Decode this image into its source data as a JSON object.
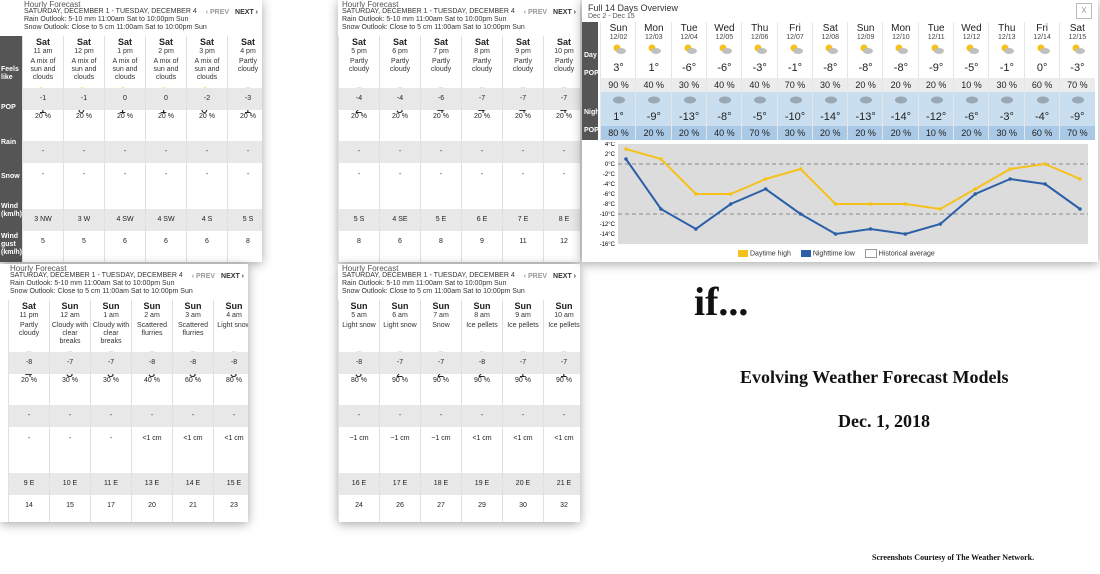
{
  "hourly_common": {
    "title": "Hourly Forecast",
    "date_range": "SATURDAY, DECEMBER 1 - TUESDAY, DECEMBER 4",
    "rain_outlook": "Rain Outlook: 5-10 mm 11:00am Sat to 10:00pm Sun",
    "snow_outlook": "Snow Outlook: Close to 5 cm 11:00am Sat to 10:00pm Sun",
    "prev": "‹ PREV",
    "next": "NEXT ›"
  },
  "row_labels": {
    "feels": "Feels like",
    "pop": "POP",
    "rain": "Rain",
    "snow": "Snow",
    "wind": "Wind (km/h)",
    "gust": "Wind gust (km/h)"
  },
  "panels": [
    {
      "cols": [
        {
          "day": "Sat",
          "time": "11 am",
          "cond": "A mix of sun and clouds",
          "icon": "sun-cloud-icon",
          "temp": "-1°",
          "feels": "-1",
          "pop": "20 %",
          "rain": "-",
          "snow": "-",
          "wind": "3 NW",
          "gust": "5"
        },
        {
          "day": "Sat",
          "time": "12 pm",
          "cond": "A mix of sun and clouds",
          "icon": "sun-cloud-icon",
          "temp": "0°",
          "feels": "-1",
          "pop": "20 %",
          "rain": "-",
          "snow": "-",
          "wind": "3 W",
          "gust": "5"
        },
        {
          "day": "Sat",
          "time": "1 pm",
          "cond": "A mix of sun and clouds",
          "icon": "sun-cloud-icon",
          "temp": "1°",
          "feels": "0",
          "pop": "20 %",
          "rain": "-",
          "snow": "-",
          "wind": "4 SW",
          "gust": "6"
        },
        {
          "day": "Sat",
          "time": "2 pm",
          "cond": "A mix of sun and clouds",
          "icon": "sun-cloud-icon",
          "temp": "1°",
          "feels": "0",
          "pop": "20 %",
          "rain": "-",
          "snow": "-",
          "wind": "4 SW",
          "gust": "6"
        },
        {
          "day": "Sat",
          "time": "3 pm",
          "cond": "A mix of sun and clouds",
          "icon": "sun-cloud-icon",
          "temp": "0°",
          "feels": "-2",
          "pop": "20 %",
          "rain": "-",
          "snow": "-",
          "wind": "4 S",
          "gust": "6"
        },
        {
          "day": "Sat",
          "time": "4 pm",
          "cond": "Partly cloudy",
          "icon": "cloud-icon",
          "temp": "-1°",
          "feels": "-3",
          "pop": "20 %",
          "rain": "-",
          "snow": "-",
          "wind": "5 S",
          "gust": "8"
        }
      ]
    },
    {
      "cols": [
        {
          "day": "Sat",
          "time": "5 pm",
          "cond": "Partly cloudy",
          "icon": "cloud-icon",
          "temp": "-2°",
          "feels": "-4",
          "pop": "20 %",
          "rain": "-",
          "snow": "-",
          "wind": "5 S",
          "gust": "8"
        },
        {
          "day": "Sat",
          "time": "6 pm",
          "cond": "Partly cloudy",
          "icon": "cloud-icon",
          "temp": "-3°",
          "feels": "-4",
          "pop": "20 %",
          "rain": "-",
          "snow": "-",
          "wind": "4 SE",
          "gust": "6"
        },
        {
          "day": "Sat",
          "time": "7 pm",
          "cond": "Partly cloudy",
          "icon": "cloud-icon",
          "temp": "-4°",
          "feels": "-6",
          "pop": "20 %",
          "rain": "-",
          "snow": "-",
          "wind": "5 E",
          "gust": "8"
        },
        {
          "day": "Sat",
          "time": "8 pm",
          "cond": "Partly cloudy",
          "icon": "cloud-icon",
          "temp": "-4°",
          "feels": "-7",
          "pop": "20 %",
          "rain": "-",
          "snow": "-",
          "wind": "6 E",
          "gust": "9"
        },
        {
          "day": "Sat",
          "time": "9 pm",
          "cond": "Partly cloudy",
          "icon": "cloud-icon",
          "temp": "-4°",
          "feels": "-7",
          "pop": "20 %",
          "rain": "-",
          "snow": "-",
          "wind": "7 E",
          "gust": "11"
        },
        {
          "day": "Sat",
          "time": "10 pm",
          "cond": "Partly cloudy",
          "icon": "cloud-icon",
          "temp": "-4°",
          "feels": "-7",
          "pop": "20 %",
          "rain": "-",
          "snow": "-",
          "wind": "8 E",
          "gust": "12"
        }
      ]
    },
    {
      "cols": [
        {
          "day": "Sat",
          "time": "11 pm",
          "cond": "Partly cloudy",
          "icon": "cloud-icon",
          "temp": "-4°",
          "feels": "-8",
          "pop": "20 %",
          "rain": "-",
          "snow": "-",
          "wind": "9 E",
          "gust": "14"
        },
        {
          "day": "Sun",
          "time": "12 am",
          "cond": "Cloudy with clear breaks",
          "icon": "cloud-icon",
          "temp": "-3°",
          "feels": "-7",
          "pop": "30 %",
          "rain": "-",
          "snow": "-",
          "wind": "10 E",
          "gust": "15"
        },
        {
          "day": "Sun",
          "time": "1 am",
          "cond": "Cloudy with clear breaks",
          "icon": "cloud-icon",
          "temp": "-3°",
          "feels": "-7",
          "pop": "30 %",
          "rain": "-",
          "snow": "-",
          "wind": "11 E",
          "gust": "17"
        },
        {
          "day": "Sun",
          "time": "2 am",
          "cond": "Scattered flurries",
          "icon": "flurries-icon",
          "temp": "-3°",
          "feels": "-8",
          "pop": "40 %",
          "rain": "-",
          "snow": "<1 cm",
          "wind": "13 E",
          "gust": "20"
        },
        {
          "day": "Sun",
          "time": "3 am",
          "cond": "Scattered flurries",
          "icon": "flurries-icon",
          "temp": "-3°",
          "feels": "-8",
          "pop": "60 %",
          "rain": "-",
          "snow": "<1 cm",
          "wind": "14 E",
          "gust": "21"
        },
        {
          "day": "Sun",
          "time": "4 am",
          "cond": "Light snow",
          "icon": "snow-icon",
          "temp": "-3°",
          "feels": "-8",
          "pop": "80 %",
          "rain": "-",
          "snow": "<1 cm",
          "wind": "15 E",
          "gust": "23"
        }
      ]
    },
    {
      "cols": [
        {
          "day": "Sun",
          "time": "5 am",
          "cond": "Light snow",
          "icon": "snow-icon",
          "temp": "-3°",
          "feels": "-8",
          "pop": "80 %",
          "rain": "-",
          "snow": "~1 cm",
          "wind": "16 E",
          "gust": "24"
        },
        {
          "day": "Sun",
          "time": "6 am",
          "cond": "Light snow",
          "icon": "snow-icon",
          "temp": "-2°",
          "feels": "-7",
          "pop": "90 %",
          "rain": "-",
          "snow": "~1 cm",
          "wind": "17 E",
          "gust": "26"
        },
        {
          "day": "Sun",
          "time": "7 am",
          "cond": "Snow",
          "icon": "snow-icon",
          "temp": "-2°",
          "feels": "-7",
          "pop": "90 %",
          "rain": "-",
          "snow": "~1 cm",
          "wind": "18 E",
          "gust": "27"
        },
        {
          "day": "Sun",
          "time": "8 am",
          "cond": "Ice pellets",
          "icon": "ice-pellets-icon",
          "temp": "-2°",
          "feels": "-8",
          "pop": "90 %",
          "rain": "-",
          "snow": "<1 cm",
          "wind": "19 E",
          "gust": "29"
        },
        {
          "day": "Sun",
          "time": "9 am",
          "cond": "Ice pellets",
          "icon": "ice-pellets-icon",
          "temp": "-1°",
          "feels": "-7",
          "pop": "90 %",
          "rain": "-",
          "snow": "<1 cm",
          "wind": "20 E",
          "gust": "30"
        },
        {
          "day": "Sun",
          "time": "10 am",
          "cond": "Ice pellets",
          "icon": "ice-pellets-icon",
          "temp": "-1°",
          "feels": "-7",
          "pop": "90 %",
          "rain": "-",
          "snow": "<1 cm",
          "wind": "21 E",
          "gust": "32"
        }
      ]
    }
  ],
  "overview": {
    "title": "Full 14 Days Overview",
    "range": "Dec 2 - Dec 15",
    "close": "X",
    "labels": {
      "day": "Day",
      "pop": "POP",
      "night": "Night"
    },
    "days": [
      {
        "day": "Sun",
        "date": "12/02",
        "day_temp": "3°",
        "day_pop": "90 %",
        "night_temp": "1°",
        "night_pop": "80 %"
      },
      {
        "day": "Mon",
        "date": "12/03",
        "day_temp": "1°",
        "day_pop": "40 %",
        "night_temp": "-9°",
        "night_pop": "20 %"
      },
      {
        "day": "Tue",
        "date": "12/04",
        "day_temp": "-6°",
        "day_pop": "30 %",
        "night_temp": "-13°",
        "night_pop": "20 %"
      },
      {
        "day": "Wed",
        "date": "12/05",
        "day_temp": "-6°",
        "day_pop": "40 %",
        "night_temp": "-8°",
        "night_pop": "40 %"
      },
      {
        "day": "Thu",
        "date": "12/06",
        "day_temp": "-3°",
        "day_pop": "40 %",
        "night_temp": "-5°",
        "night_pop": "70 %"
      },
      {
        "day": "Fri",
        "date": "12/07",
        "day_temp": "-1°",
        "day_pop": "70 %",
        "night_temp": "-10°",
        "night_pop": "30 %"
      },
      {
        "day": "Sat",
        "date": "12/08",
        "day_temp": "-8°",
        "day_pop": "30 %",
        "night_temp": "-14°",
        "night_pop": "20 %"
      },
      {
        "day": "Sun",
        "date": "12/09",
        "day_temp": "-8°",
        "day_pop": "20 %",
        "night_temp": "-13°",
        "night_pop": "20 %"
      },
      {
        "day": "Mon",
        "date": "12/10",
        "day_temp": "-8°",
        "day_pop": "20 %",
        "night_temp": "-14°",
        "night_pop": "20 %"
      },
      {
        "day": "Tue",
        "date": "12/11",
        "day_temp": "-9°",
        "day_pop": "20 %",
        "night_temp": "-12°",
        "night_pop": "10 %"
      },
      {
        "day": "Wed",
        "date": "12/12",
        "day_temp": "-5°",
        "day_pop": "10 %",
        "night_temp": "-6°",
        "night_pop": "20 %"
      },
      {
        "day": "Thu",
        "date": "12/13",
        "day_temp": "-1°",
        "day_pop": "30 %",
        "night_temp": "-3°",
        "night_pop": "30 %"
      },
      {
        "day": "Fri",
        "date": "12/14",
        "day_temp": "0°",
        "day_pop": "60 %",
        "night_temp": "-4°",
        "night_pop": "60 %"
      },
      {
        "day": "Sat",
        "date": "12/15",
        "day_temp": "-3°",
        "day_pop": "70 %",
        "night_temp": "-9°",
        "night_pop": "70 %"
      }
    ],
    "legend": {
      "high": "Daytime high",
      "low": "Nighttime low",
      "avg": "Historical average"
    },
    "colors": {
      "high": "#f5c21b",
      "low": "#2b5fa8",
      "avg": "#999999"
    }
  },
  "chart_data": {
    "type": "line",
    "x": [
      "12/02",
      "12/03",
      "12/04",
      "12/05",
      "12/06",
      "12/07",
      "12/08",
      "12/09",
      "12/10",
      "12/11",
      "12/12",
      "12/13",
      "12/14",
      "12/15"
    ],
    "series": [
      {
        "name": "Daytime high",
        "values": [
          3,
          1,
          -6,
          -6,
          -3,
          -1,
          -8,
          -8,
          -8,
          -9,
          -5,
          -1,
          0,
          -3
        ]
      },
      {
        "name": "Nighttime low",
        "values": [
          1,
          -9,
          -13,
          -8,
          -5,
          -10,
          -14,
          -13,
          -14,
          -12,
          -6,
          -3,
          -4,
          -9
        ]
      },
      {
        "name": "Historical average",
        "values": [
          0,
          0,
          0,
          0,
          0,
          0,
          0,
          0,
          0,
          0,
          0,
          0,
          0,
          0
        ],
        "secondary": [
          -10,
          -10,
          -10,
          -10,
          -10,
          -10,
          -10,
          -10,
          -10,
          -10,
          -10,
          -10,
          -10,
          -10
        ]
      }
    ],
    "yticks": [
      "4°C",
      "2°C",
      "0°C",
      "-2°C",
      "-4°C",
      "-6°C",
      "-8°C",
      "-10°C",
      "-12°C",
      "-14°C",
      "-16°C"
    ],
    "ylim": [
      -16,
      4
    ]
  },
  "slide": {
    "if_text": "if...",
    "heading": "Evolving Weather Forecast Models",
    "date": "Dec. 1, 2018",
    "credit": "Screenshots Courtesy of The Weather Network."
  }
}
